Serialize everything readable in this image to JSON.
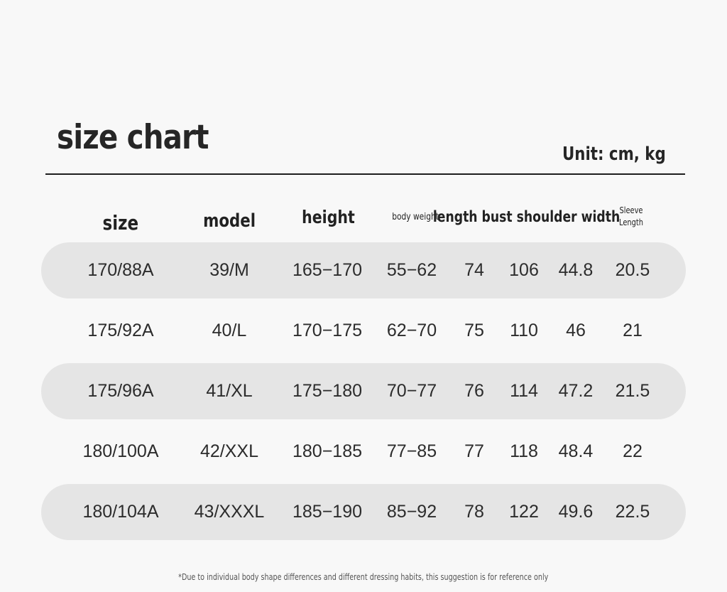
{
  "title": "size chart",
  "unit": "Unit: cm, kg",
  "headers": {
    "size": "size",
    "model": "model",
    "height": "height",
    "body_weight": "body weight",
    "dims": "length bust shoulder width",
    "sleeve": "Sleeve Length"
  },
  "rows": [
    {
      "size": "170/88A",
      "model": "39/M",
      "height": "165−170",
      "weight": "55−62",
      "length": "74",
      "bust": "106",
      "shoulder": "44.8",
      "sleeve": "20.5"
    },
    {
      "size": "175/92A",
      "model": "40/L",
      "height": "170−175",
      "weight": "62−70",
      "length": "75",
      "bust": "110",
      "shoulder": "46",
      "sleeve": "21"
    },
    {
      "size": "175/96A",
      "model": "41/XL",
      "height": "175−180",
      "weight": "70−77",
      "length": "76",
      "bust": "114",
      "shoulder": "47.2",
      "sleeve": "21.5"
    },
    {
      "size": "180/100A",
      "model": "42/XXL",
      "height": "180−185",
      "weight": "77−85",
      "length": "77",
      "bust": "118",
      "shoulder": "48.4",
      "sleeve": "22"
    },
    {
      "size": "180/104A",
      "model": "43/XXXL",
      "height": "185−190",
      "weight": "85−92",
      "length": "78",
      "bust": "122",
      "shoulder": "49.6",
      "sleeve": "22.5"
    }
  ],
  "note": "*Due to individual body shape differences and different dressing habits, this suggestion is for reference only",
  "colors": {
    "shade": "#e5e5e5",
    "background": "#f8f8f8",
    "text": "#2c2c2c"
  }
}
